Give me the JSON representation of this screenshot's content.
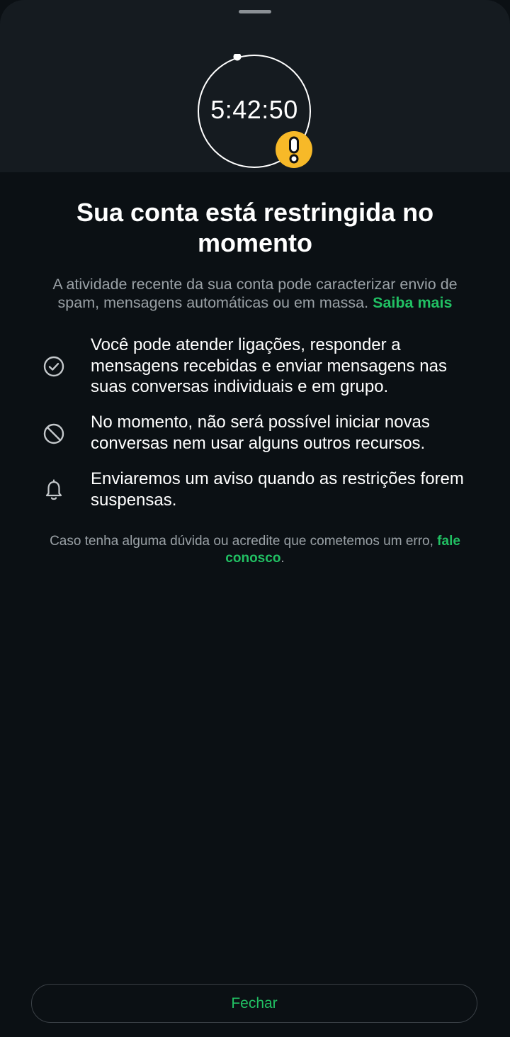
{
  "timer": {
    "value": "5:42:50"
  },
  "title": "Sua conta está restringida no momento",
  "description": {
    "text": "A atividade recente da sua conta pode caracterizar envio de spam, mensagens automáticas ou em massa.",
    "link": "Saiba mais"
  },
  "items": [
    {
      "icon": "check-circle-icon",
      "text": "Você pode atender ligações, responder a mensagens recebidas e enviar mensagens nas suas conversas individuais e em grupo."
    },
    {
      "icon": "block-icon",
      "text": "No momento, não será possível iniciar novas conversas nem usar alguns outros recursos."
    },
    {
      "icon": "bell-icon",
      "text": "Enviaremos um aviso quando as restrições forem suspensas."
    }
  ],
  "footer": {
    "text": "Caso tenha alguma dúvida ou acredite que cometemos um erro,",
    "link": "fale conosco",
    "end": "."
  },
  "close_button": {
    "label": "Fechar"
  },
  "colors": {
    "background": "#0b1014",
    "header_band": "#151b20",
    "accent_green": "#21c063",
    "warning_yellow": "#f7b928",
    "muted_text": "#9aa1a6"
  }
}
